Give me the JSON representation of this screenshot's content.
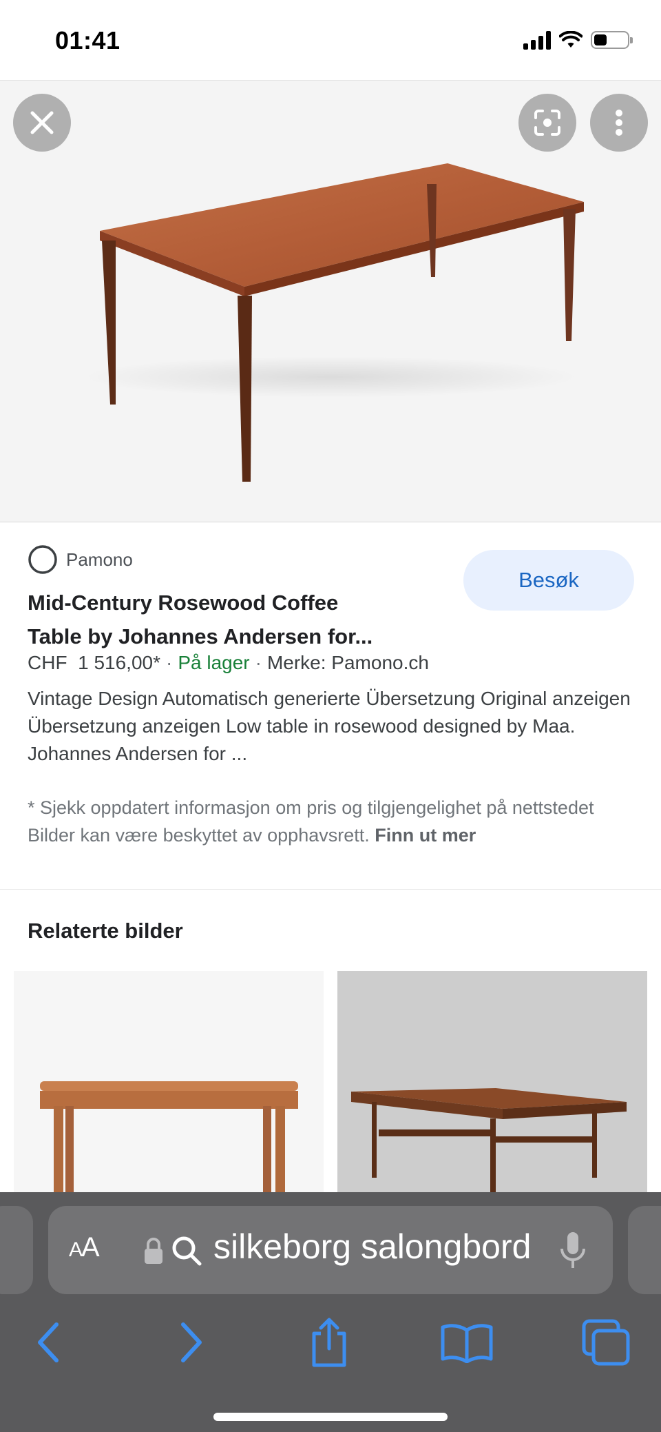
{
  "status_bar": {
    "time": "01:41",
    "battery_level": 0.4
  },
  "hero": {
    "image_alt": "Rosewood coffee table",
    "buttons": [
      "close-icon",
      "lens-icon",
      "more-vert-icon"
    ]
  },
  "result": {
    "source": "Pamono",
    "visit_label": "Besøk",
    "title_line1": "Mid-Century Rosewood Coffee",
    "title_line2": "Table by Johannes Andersen for...",
    "currency": "CHF",
    "price": "1 516,00*",
    "separator": "·",
    "stock": "På lager",
    "brand": "Merke: Pamono.ch",
    "description": "Vintage Design Automatisch generierte Übersetzung Original anzeigen Übersetzung anzeigen Low table in rosewood designed by Maa. Johannes Andersen for ...",
    "notice": "* Sjekk oppdatert informasjon om pris og tilgjengelighet på nettstedet Bilder kan være beskyttet av opphavsrett.",
    "notice_link": "Finn ut mer"
  },
  "related": {
    "title": "Relaterte bilder"
  },
  "safari": {
    "aa_label_small": "A",
    "aa_label_large": "A",
    "url_text": "silkeborg salongbord",
    "toolbar": [
      "back-icon",
      "forward-icon",
      "share-icon",
      "bookmarks-icon",
      "tabs-icon"
    ]
  },
  "colors": {
    "accent": "#1a66c2",
    "visit_bg": "#e8f0fe",
    "stock": "#188038",
    "safari_bg": "#5a5a5c",
    "toolbar_icon": "#3d8ef0"
  }
}
